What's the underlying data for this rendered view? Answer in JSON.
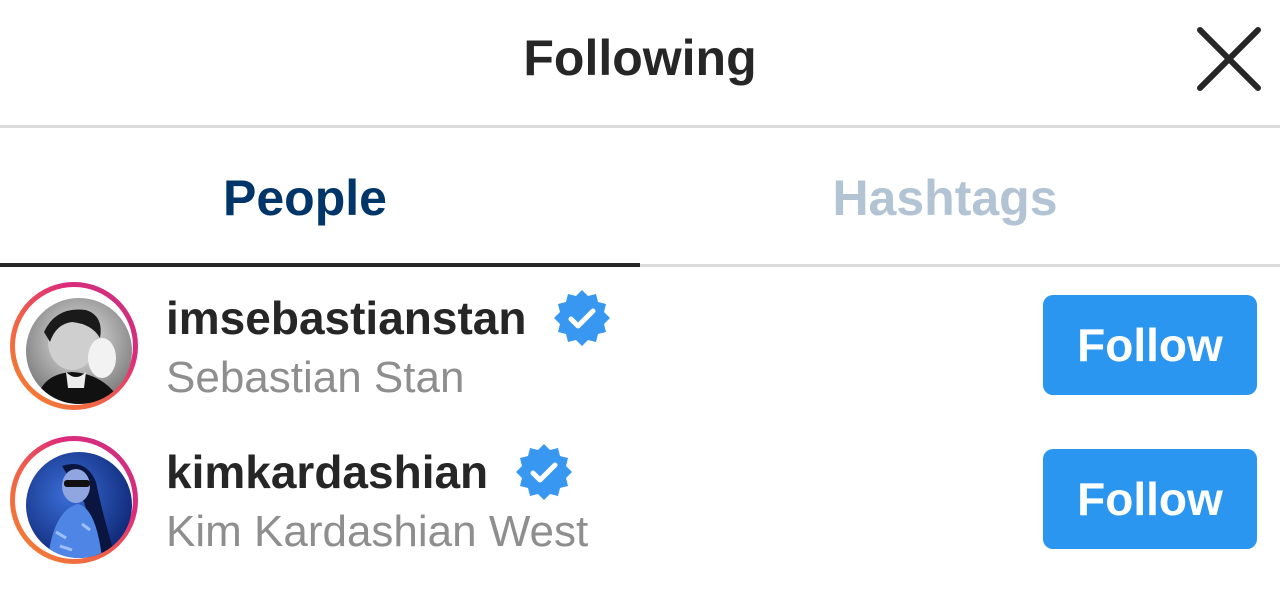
{
  "header": {
    "title": "Following",
    "close_icon": "close-icon"
  },
  "tabs": [
    {
      "label": "People",
      "active": true
    },
    {
      "label": "Hashtags",
      "active": false
    }
  ],
  "people": [
    {
      "username": "imsebastianstan",
      "full_name": "Sebastian Stan",
      "verified": true,
      "follow_label": "Follow"
    },
    {
      "username": "kimkardashian",
      "full_name": "Kim Kardashian West",
      "verified": true,
      "follow_label": "Follow"
    }
  ],
  "colors": {
    "follow_button": "#2a96ef",
    "active_tab": "#003569",
    "inactive_tab": "#b2c3d4",
    "verified_badge": "#3897f0",
    "secondary_text": "#8e8e8e"
  }
}
